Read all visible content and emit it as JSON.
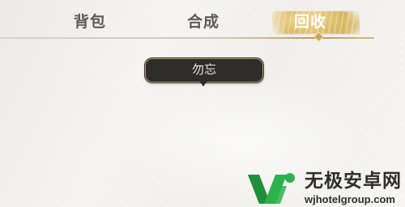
{
  "tabs": {
    "bag": "背包",
    "craft": "合成",
    "recycle": "回收",
    "active": "recycle"
  },
  "tooltip": {
    "text": "勿忘"
  },
  "watermark": {
    "title": "无极安卓网",
    "url": "wjhotelgroup.com"
  },
  "colors": {
    "active_tab_highlight": "#d9b864",
    "tab_text": "#5e5a54",
    "tooltip_bg": "#2f2c29",
    "tooltip_border": "#b19a6b",
    "logo_green": "#2bb24c"
  }
}
